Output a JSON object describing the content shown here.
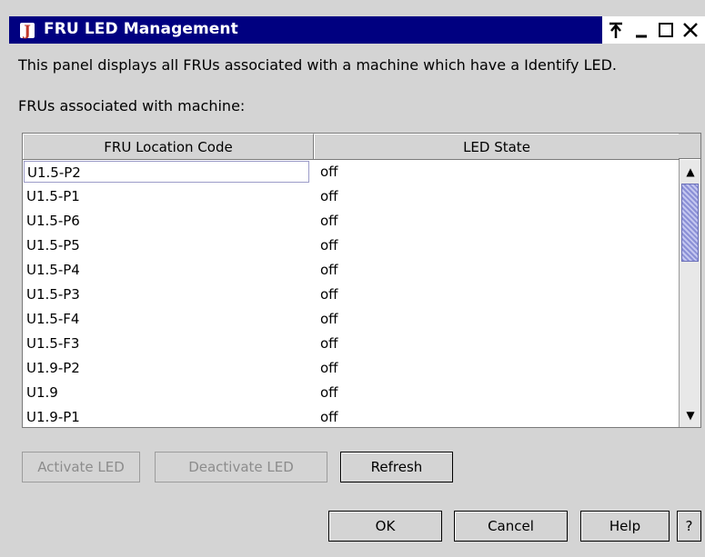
{
  "window": {
    "title": "FRU LED Management",
    "app_icon": "J",
    "controls": [
      "pin",
      "minimize",
      "maximize",
      "close"
    ]
  },
  "description": "This panel displays all FRUs associated with a machine which have a Identify LED.",
  "associated_label": "FRUs associated with machine:",
  "table": {
    "columns": [
      "FRU Location Code",
      "LED State"
    ],
    "rows": [
      {
        "location": "U1.5-P2",
        "state": "off"
      },
      {
        "location": "U1.5-P1",
        "state": "off"
      },
      {
        "location": "U1.5-P6",
        "state": "off"
      },
      {
        "location": "U1.5-P5",
        "state": "off"
      },
      {
        "location": "U1.5-P4",
        "state": "off"
      },
      {
        "location": "U1.5-P3",
        "state": "off"
      },
      {
        "location": "U1.5-F4",
        "state": "off"
      },
      {
        "location": "U1.5-F3",
        "state": "off"
      },
      {
        "location": "U1.9-P2",
        "state": "off"
      },
      {
        "location": "U1.9",
        "state": "off"
      },
      {
        "location": "U1.9-P1",
        "state": "off"
      }
    ]
  },
  "actions": {
    "activate": "Activate LED",
    "deactivate": "Deactivate LED",
    "refresh": "Refresh"
  },
  "dialog_buttons": {
    "ok": "OK",
    "cancel": "Cancel",
    "help": "Help",
    "context_help": "?"
  },
  "colors": {
    "titlebar": "#000080",
    "background": "#d4d4d4",
    "scroll_thumb": "#8a8fd6"
  }
}
